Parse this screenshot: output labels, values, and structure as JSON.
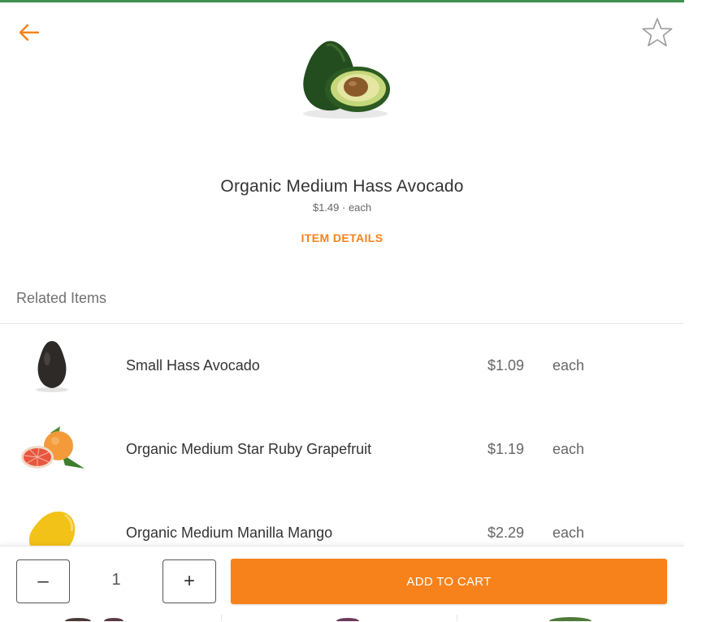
{
  "header": {
    "back_icon": "arrow-left-icon",
    "favorite_icon": "star-outline-icon"
  },
  "product": {
    "name": "Organic Medium Hass Avocado",
    "price_line": "$1.49 · each",
    "details_link": "ITEM DETAILS"
  },
  "related": {
    "heading": "Related Items",
    "items": [
      {
        "name": "Small Hass Avocado",
        "price": "$1.09",
        "unit": "each"
      },
      {
        "name": "Organic Medium Star Ruby Grapefruit",
        "price": "$1.19",
        "unit": "each"
      },
      {
        "name": "Organic Medium Manilla Mango",
        "price": "$2.29",
        "unit": "each"
      }
    ]
  },
  "cart": {
    "minus_label": "–",
    "quantity": "1",
    "plus_label": "+",
    "add_label": "ADD TO CART"
  },
  "colors": {
    "accent": "#f7821b",
    "top_strip": "#3f8f4f"
  }
}
